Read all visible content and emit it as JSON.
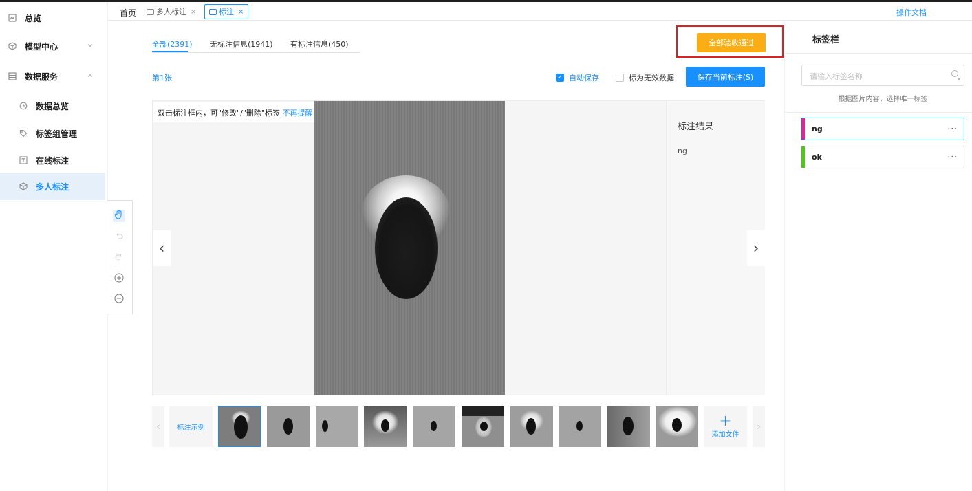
{
  "sidebar": {
    "items": [
      {
        "label": "总览",
        "icon": "overview-icon"
      },
      {
        "label": "模型中心",
        "icon": "cube-icon"
      },
      {
        "label": "数据服务",
        "icon": "database-icon"
      },
      {
        "label": "数据总览",
        "icon": "clock-icon"
      },
      {
        "label": "标签组管理",
        "icon": "tag-icon"
      },
      {
        "label": "在线标注",
        "icon": "text-box-icon"
      },
      {
        "label": "多人标注",
        "icon": "cube-outline-icon"
      }
    ],
    "active_index": 6
  },
  "tabbar": {
    "home": "首页",
    "tabs": [
      {
        "label": "多人标注"
      },
      {
        "label": "标注"
      }
    ],
    "close_glyph": "×",
    "doc_link": "操作文档"
  },
  "main": {
    "filter_tabs": [
      "全部(2391)",
      "无标注信息(1941)",
      "有标注信息(450)"
    ],
    "accept_all": "全部验收通过",
    "page_no": "第1张",
    "auto_save": "自动保存",
    "mark_invalid": "标为无效数据",
    "save_current": "保存当前标注(S)",
    "hint_text": "双击标注框内，可\"修改\"/\"删除\"标签",
    "hint_link": "不再提醒",
    "result_title": "标注结果",
    "result_value": "ng",
    "prev_glyph": "‹",
    "next_glyph": "›",
    "strip_prev": "‹",
    "strip_next": "›",
    "example_label": "标注示例",
    "add_file_plus": "+",
    "add_file_label": "添加文件"
  },
  "right_panel": {
    "title": "标签栏",
    "search_placeholder": "请输入标签名称",
    "tip": "根据图片内容，选择唯一标签",
    "labels": [
      {
        "name": "ng",
        "color": "#e0288c",
        "more": "···"
      },
      {
        "name": "ok",
        "color": "#52c41a",
        "more": "···"
      }
    ]
  },
  "colors": {
    "primary": "#1890ff",
    "accept": "#faad14",
    "highlight_box": "#e02020"
  }
}
